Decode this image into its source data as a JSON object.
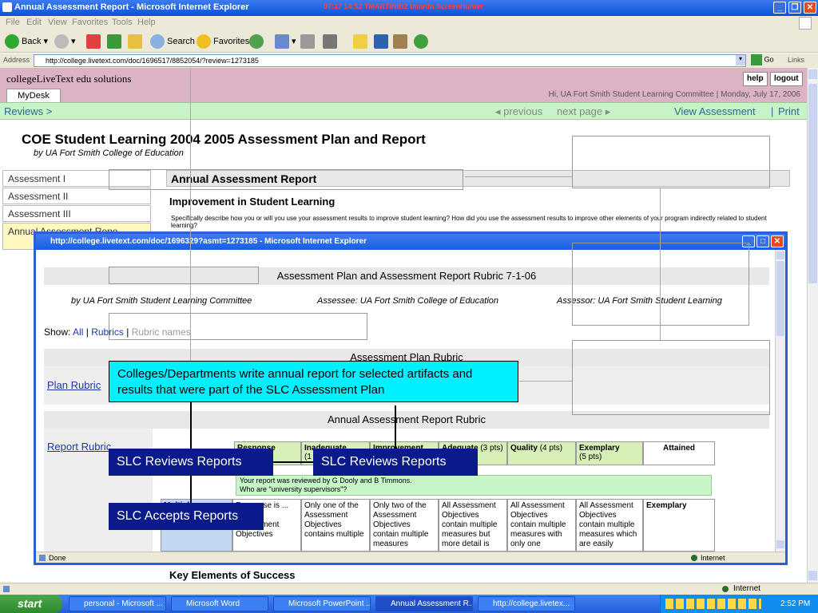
{
  "window": {
    "title": "Annual Assessment Report - Microsoft Internet Explorer",
    "capture_text": "07:17 14:52 TMARTINIB2 tmartin ScreenHunter"
  },
  "menu": [
    "File",
    "Edit",
    "View",
    "Favorites",
    "Tools",
    "Help"
  ],
  "toolbar": {
    "back": "Back",
    "search": "Search",
    "favorites": "Favorites"
  },
  "address": {
    "label": "Address",
    "url": "http://college.livetext.com/doc/1696517/8852054/?review=1273185",
    "go": "Go",
    "links": "Links"
  },
  "page": {
    "logo": "collegeLiveText edu solutions",
    "help": "help",
    "logout": "logout",
    "mydesk": "MyDesk",
    "greeting": "Hi, UA Fort Smith Student Learning Committee  |  Monday, July 17, 2006",
    "nav": {
      "reviews": "Reviews >",
      "previous": "◂ previous",
      "next": "next page ▸",
      "view": "View Assessment",
      "sep": "|",
      "print": "Print"
    },
    "title": "COE Student Learning 2004 2005 Assessment Plan and Report",
    "subtitle": "by UA Fort Smith College of Education",
    "sidebar": [
      "Assessment I",
      "Assessment II",
      "Assessment III",
      "Annual Assessment Repo"
    ],
    "section_header": "Annual Assessment Report",
    "improvement_heading": "Improvement in Student Learning",
    "describe_text": "Specifically describe how you or will you use your assessment results to improve student learning?  How did you use the assessment results to improve other elements of your program indirectly related to student learning?",
    "key_elements": "Key Elements of Success"
  },
  "popup": {
    "title": "http://college.livetext.com/doc/1696329?asmt=1273185 - Microsoft Internet Explorer",
    "heading": "Assessment Plan and Assessment Report Rubric 7-1-06",
    "by": "by UA Fort Smith Student Learning Committee",
    "assessee": "Assessee: UA Fort Smith College of Education",
    "assessor": "Assessor: UA Fort Smith Student Learning",
    "show_label": "Show:",
    "show_all": "All",
    "show_rubrics": "Rubrics",
    "show_names": "Rubric names",
    "sep": "|",
    "plan_rubric_header": "Assessment Plan Rubric",
    "plan_rubric_link": "Plan Rubric",
    "report_rubric_header": "Annual Assessment Report Rubric",
    "report_rubric_link": "Report Rubric",
    "columns": [
      {
        "label": "Response",
        "pts": ""
      },
      {
        "label": "Inadequate",
        "pts": "(1 pt)"
      },
      {
        "label": "Improvement",
        "pts": ""
      },
      {
        "label": "Adequate",
        "pts": "(3 pts)"
      },
      {
        "label": "Quality",
        "pts": "(4 pts)"
      },
      {
        "label": "Exemplary",
        "pts": "(5 pts)"
      },
      {
        "label": "Attained",
        "pts": ""
      }
    ],
    "review_note": "Your report was reviewed by G Dooly and B Timmons.\nWho are \"university supervisors\"?",
    "row_label": "Multiple",
    "row_cells": [
      "Response is ... none Assessment Objectives",
      "Only one of the Assessment Objectives contains multiple",
      "Only two of the Assessment Objectives contain multiple measures",
      "All Assessment Objectives contain multiple measures but more detail is",
      "All Assessment Objectives contain multiple measures with only one",
      "All Assessment Objectives contain multiple measures which are easily",
      "Exemplary"
    ],
    "status": "Done",
    "zone": "Internet"
  },
  "overlay": {
    "cyan_box": "Colleges/Departments write annual report for selected artifacts and results that were part of the SLC Assessment Plan",
    "slc_reviews_1": "SLC Reviews Reports",
    "slc_reviews_2": "SLC Reviews Reports",
    "slc_accepts": "SLC Accepts Reports"
  },
  "status_bar": {
    "zone": "Internet"
  },
  "taskbar": {
    "start": "start",
    "tasks": [
      "personal - Microsoft ...",
      "Microsoft Word",
      "Microsoft PowerPoint ...",
      "Annual Assessment R...",
      "http://college.livetex..."
    ],
    "clock": "2:52 PM"
  },
  "colors": {
    "title_blue": "#0a52d6",
    "brand_pink": "#dcb3c4",
    "nav_green": "#c8f2c8",
    "cyan_box": "#00f0ff",
    "navy_box": "#0a1a8a"
  }
}
